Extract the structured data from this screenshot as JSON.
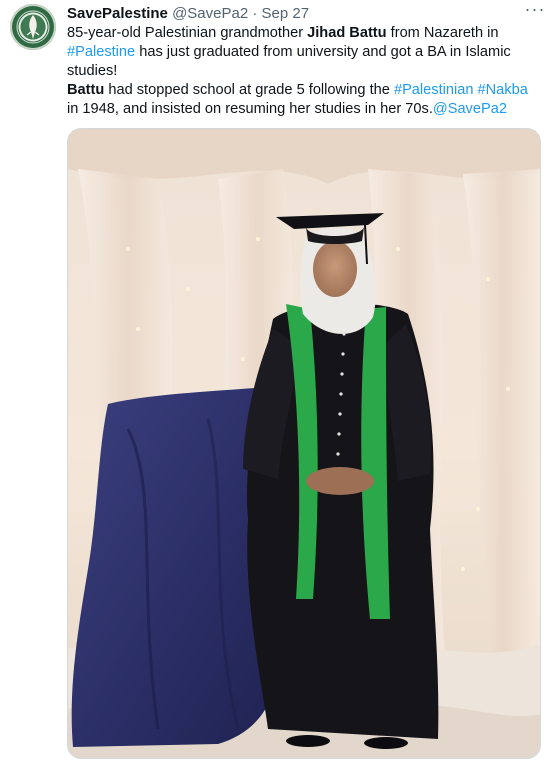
{
  "author": {
    "name": "SavePalestine",
    "handle": "@SavePa2",
    "separator": "·",
    "date": "Sep 27",
    "avatar_icon": "palestine-emblem-icon"
  },
  "more_icon": "more-horizontal-icon",
  "more_glyph": "···",
  "tweet": {
    "line1_prefix": "85-year-old Palestinian grandmother ",
    "line1_bold": "Jihad Battu",
    "line1_suffix": " from Nazareth in ",
    "hashtag_palestine": "#Palestine",
    "line2_text": " has just graduated from university and got a BA in Islamic studies!",
    "para2_bold": "Battu",
    "para2_text1": " had stopped school at grade 5 following the ",
    "hashtag_palestinian": "#Palestinian",
    "hashtag_nakba": "#Nakba",
    "para2_text2": " in 1948, and insisted on resuming her studies in her 70s.",
    "mention": "@SavePa2"
  },
  "media": {
    "alt_subject": "graduation-photo"
  },
  "colors": {
    "link": "#1d9bf0",
    "secondary": "#536471",
    "gown": "#151419",
    "stole": "#2aa84a",
    "drape": "#2c2f66"
  }
}
